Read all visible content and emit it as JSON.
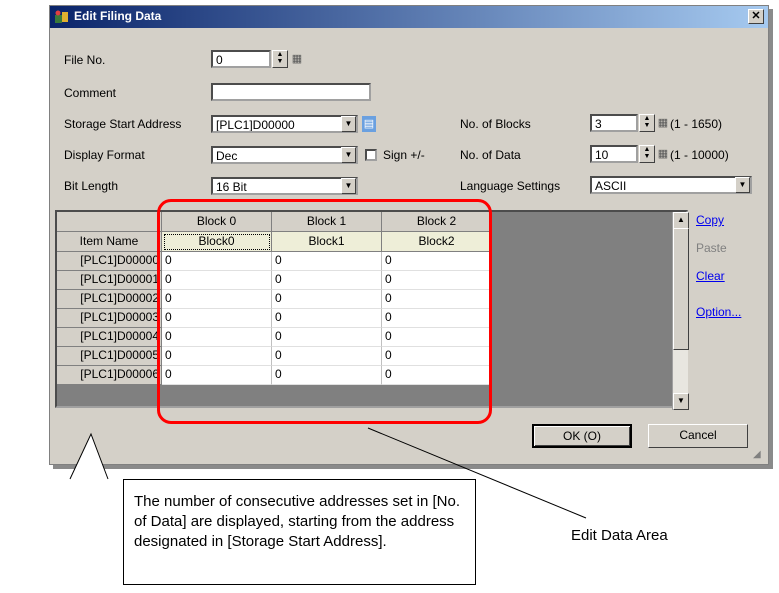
{
  "dialog": {
    "title": "Edit Filing Data",
    "close_glyph": "✕"
  },
  "form": {
    "file_no": {
      "label": "File No.",
      "value": "0"
    },
    "comment": {
      "label": "Comment",
      "value": ""
    },
    "storage_start_address": {
      "label": "Storage Start Address",
      "value": "[PLC1]D00000"
    },
    "display_format": {
      "label": "Display Format",
      "value": "Dec"
    },
    "sign": {
      "label": "Sign +/-",
      "checked": false
    },
    "bit_length": {
      "label": "Bit Length",
      "value": "16 Bit"
    },
    "no_of_blocks": {
      "label": "No. of Blocks",
      "value": "3",
      "range": "(1 - 1650)"
    },
    "no_of_data": {
      "label": "No. of Data",
      "value": "10",
      "range": "(1 - 10000)"
    },
    "language_settings": {
      "label": "Language Settings",
      "value": "ASCII"
    }
  },
  "table": {
    "item_name_header": "Item Name",
    "columns": [
      {
        "header": "Block 0",
        "name": "Block0"
      },
      {
        "header": "Block 1",
        "name": "Block1"
      },
      {
        "header": "Block 2",
        "name": "Block2"
      }
    ],
    "rows": [
      {
        "address": "[PLC1]D00000",
        "values": [
          "0",
          "0",
          "0"
        ]
      },
      {
        "address": "[PLC1]D00001",
        "values": [
          "0",
          "0",
          "0"
        ]
      },
      {
        "address": "[PLC1]D00002",
        "values": [
          "0",
          "0",
          "0"
        ]
      },
      {
        "address": "[PLC1]D00003",
        "values": [
          "0",
          "0",
          "0"
        ]
      },
      {
        "address": "[PLC1]D00004",
        "values": [
          "0",
          "0",
          "0"
        ]
      },
      {
        "address": "[PLC1]D00005",
        "values": [
          "0",
          "0",
          "0"
        ]
      },
      {
        "address": "[PLC1]D00006",
        "values": [
          "0",
          "0",
          "0"
        ]
      }
    ]
  },
  "side_actions": {
    "copy": "Copy",
    "paste": "Paste",
    "clear": "Clear",
    "option": "Option..."
  },
  "buttons": {
    "ok": "OK (O)",
    "cancel": "Cancel"
  },
  "annotations": {
    "callout_text": "The number of consecutive addresses set in [No. of Data] are displayed, starting from the address designated in [Storage Start Address].",
    "edit_data_area": "Edit Data Area"
  },
  "colors": {
    "highlight": "#ff0000",
    "title_bar_start": "#0a246a",
    "dialog_face": "#d4d0c8"
  }
}
